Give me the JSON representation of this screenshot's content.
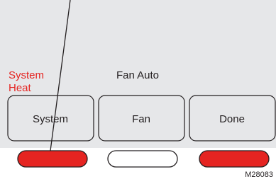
{
  "display": {
    "system_label": {
      "line1": "System",
      "line2": "Heat"
    },
    "fan_label": "Fan Auto"
  },
  "buttons": [
    {
      "id": "system",
      "label": "System"
    },
    {
      "id": "fan",
      "label": "Fan"
    },
    {
      "id": "done",
      "label": "Done"
    }
  ],
  "indicators": [
    {
      "id": "left",
      "state": "red"
    },
    {
      "id": "middle",
      "state": "white"
    },
    {
      "id": "right",
      "state": "red"
    }
  ],
  "figure_code": "M28083",
  "colors": {
    "screen": "#e6e7e9",
    "accent_red": "#e52421",
    "button_fill": "#e6e7e9",
    "outline": "#231f20"
  }
}
